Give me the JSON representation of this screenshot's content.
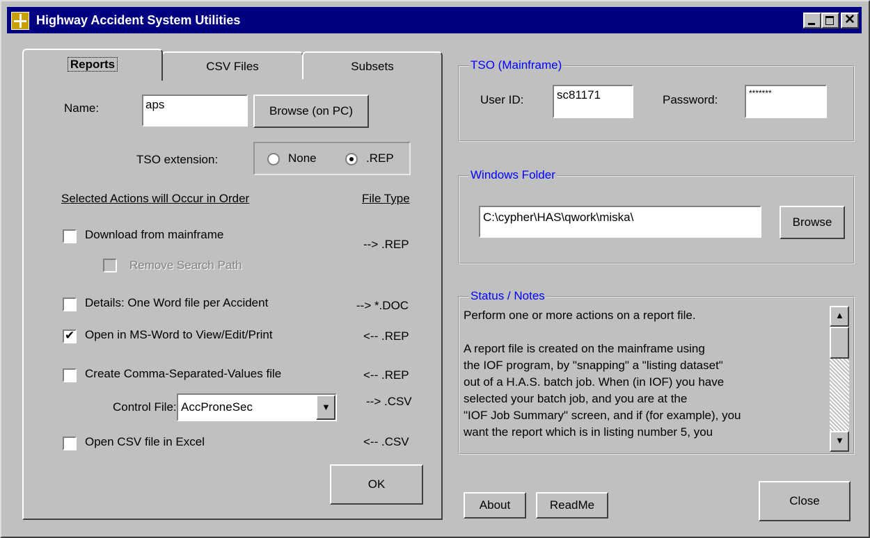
{
  "window": {
    "title": "Highway Accident System Utilities"
  },
  "tabs": [
    {
      "label": "Reports"
    },
    {
      "label": "CSV Files"
    },
    {
      "label": "Subsets"
    }
  ],
  "reports": {
    "name_label": "Name:",
    "name_value": "aps",
    "browse_pc_label": "Browse (on PC)",
    "tso_ext_label": "TSO extension:",
    "radio_none": "None",
    "radio_rep": ".REP",
    "actions_header": "Selected Actions will Occur in Order",
    "filetype_header": "File Type",
    "actions": [
      {
        "label": "Download from mainframe",
        "type": "--> .REP",
        "checked": false
      },
      {
        "label": "Remove Search Path",
        "disabled": true
      },
      {
        "label": "Details: One Word file per Accident",
        "type": "--> *.DOC",
        "checked": false
      },
      {
        "label": "Open in MS-Word to View/Edit/Print",
        "type": "<-- .REP",
        "checked": true
      },
      {
        "label": "Create Comma-Separated-Values file",
        "type": "<-- .REP",
        "checked": false
      },
      {
        "label": "Open CSV file in Excel",
        "type": "<-- .CSV",
        "checked": false
      }
    ],
    "control_file_label": "Control File:",
    "control_file_value": "AccProneSec",
    "control_file_type": "--> .CSV",
    "ok_label": "OK"
  },
  "tso": {
    "title": "TSO (Mainframe)",
    "userid_label": "User ID:",
    "userid_value": "sc81171",
    "password_label": "Password:",
    "password_value": "*******"
  },
  "windows_folder": {
    "title": "Windows Folder",
    "path": "C:\\cypher\\HAS\\qwork\\miska\\",
    "browse_label": "Browse"
  },
  "status": {
    "title": "Status / Notes",
    "lines": [
      "Perform one or more actions on a report file.",
      "",
      "A report file is created on the mainframe using",
      "the IOF program, by \"snapping\" a \"listing dataset\"",
      "out of a H.A.S. batch job.  When (in IOF) you have",
      "selected your batch job, and you are at the",
      "\"IOF Job Summary\" screen, and if (for example), you",
      "want the report which is in listing number 5, you"
    ]
  },
  "footer": {
    "about": "About",
    "readme": "ReadMe",
    "close": "Close"
  }
}
